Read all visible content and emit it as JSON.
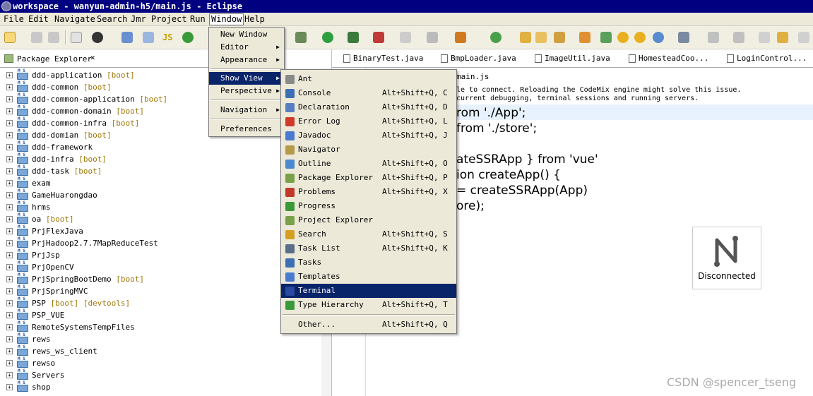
{
  "window": {
    "title": "workspace - wanyun-admin-h5/main.js - Eclipse"
  },
  "menubar": [
    "File",
    "Edit",
    "Navigate",
    "Search",
    "Jmr",
    "Project",
    "Run",
    "Window",
    "Help"
  ],
  "package_explorer": {
    "tab_label": "Package Explorer",
    "items": [
      {
        "name": "ddd-application",
        "tag": "[boot]"
      },
      {
        "name": "ddd-common",
        "tag": "[boot]"
      },
      {
        "name": "ddd-common-application",
        "tag": "[boot]"
      },
      {
        "name": "ddd-common-domain",
        "tag": "[boot]"
      },
      {
        "name": "ddd-common-infra",
        "tag": "[boot]"
      },
      {
        "name": "ddd-domian",
        "tag": "[boot]"
      },
      {
        "name": "ddd-framework",
        "tag": ""
      },
      {
        "name": "ddd-infra",
        "tag": "[boot]"
      },
      {
        "name": "ddd-task",
        "tag": "[boot]"
      },
      {
        "name": "exam",
        "tag": ""
      },
      {
        "name": "GameHuarongdao",
        "tag": ""
      },
      {
        "name": "hrms",
        "tag": ""
      },
      {
        "name": "oa",
        "tag": "[boot]"
      },
      {
        "name": "PrjFlexJava",
        "tag": ""
      },
      {
        "name": "PrjHadoop2.7.7MapReduceTest",
        "tag": ""
      },
      {
        "name": "PrjJsp",
        "tag": ""
      },
      {
        "name": "PrjOpenCV",
        "tag": ""
      },
      {
        "name": "PrjSpringBootDemo",
        "tag": "[boot]"
      },
      {
        "name": "PrjSpringMVC",
        "tag": ""
      },
      {
        "name": "PSP",
        "tag": "[boot] [devtools]"
      },
      {
        "name": "PSP_VUE",
        "tag": ""
      },
      {
        "name": "RemoteSystemsTempFiles",
        "tag": ""
      },
      {
        "name": "rews",
        "tag": ""
      },
      {
        "name": "rews_ws_client",
        "tag": ""
      },
      {
        "name": "rewso",
        "tag": ""
      },
      {
        "name": "Servers",
        "tag": ""
      },
      {
        "name": "shop",
        "tag": ""
      }
    ]
  },
  "editor_tabs": [
    "BinaryTest.java",
    "BmpLoader.java",
    "ImageUtil.java",
    "HomesteadCoo...",
    "LoginControl..."
  ],
  "editor": {
    "file_name": "main.js",
    "warning_line1": "le to connect. Reloading the CodeMix engine might solve this issue.",
    "warning_line2": "current debugging, terminal sessions and running servers.",
    "code_lines": [
      "rom './App';",
      " from './store';",
      "",
      "ateSSRApp } from 'vue'",
      "ion createApp() {",
      "= createSSRApp(App)",
      "ore);"
    ]
  },
  "disconnected_label": "Disconnected",
  "watermark": "CSDN @spencer_tseng",
  "window_menu": {
    "items": [
      "New Window",
      "Editor",
      "Appearance",
      "Show View",
      "Perspective",
      "Navigation",
      "Preferences"
    ]
  },
  "show_view_menu": {
    "items": [
      {
        "label": "Ant",
        "shortcut": "",
        "icon_color": "#8a8a8a"
      },
      {
        "label": "Console",
        "shortcut": "Alt+Shift+Q, C",
        "icon_color": "#3d6fb6"
      },
      {
        "label": "Declaration",
        "shortcut": "Alt+Shift+Q, D",
        "icon_color": "#5a7fc0"
      },
      {
        "label": "Error Log",
        "shortcut": "Alt+Shift+Q, L",
        "icon_color": "#d03a2a"
      },
      {
        "label": "Javadoc",
        "shortcut": "Alt+Shift+Q, J",
        "icon_color": "#4a7bd0"
      },
      {
        "label": "Navigator",
        "shortcut": "",
        "icon_color": "#b59a4a"
      },
      {
        "label": "Outline",
        "shortcut": "Alt+Shift+Q, O",
        "icon_color": "#4a8ad0"
      },
      {
        "label": "Package Explorer",
        "shortcut": "Alt+Shift+Q, P",
        "icon_color": "#7aa04a"
      },
      {
        "label": "Problems",
        "shortcut": "Alt+Shift+Q, X",
        "icon_color": "#c0392b"
      },
      {
        "label": "Progress",
        "shortcut": "",
        "icon_color": "#3a9a3a"
      },
      {
        "label": "Project Explorer",
        "shortcut": "",
        "icon_color": "#7aa04a"
      },
      {
        "label": "Search",
        "shortcut": "Alt+Shift+Q, S",
        "icon_color": "#d4a020"
      },
      {
        "label": "Task List",
        "shortcut": "Alt+Shift+Q, K",
        "icon_color": "#5a6f8a"
      },
      {
        "label": "Tasks",
        "shortcut": "",
        "icon_color": "#3d6fb6"
      },
      {
        "label": "Templates",
        "shortcut": "",
        "icon_color": "#4a7bd0"
      },
      {
        "label": "Terminal",
        "shortcut": "",
        "icon_color": "#2a4aa0"
      },
      {
        "label": "Type Hierarchy",
        "shortcut": "Alt+Shift+Q, T",
        "icon_color": "#3a9a3a"
      },
      {
        "label": "Other...",
        "shortcut": "Alt+Shift+Q, Q",
        "icon_color": ""
      }
    ]
  }
}
